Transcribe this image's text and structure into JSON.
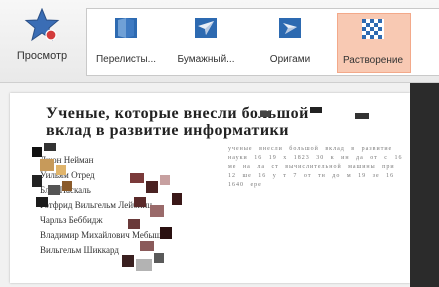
{
  "ribbon": {
    "preview_label": "Просмотр",
    "gallery": [
      {
        "label": "Перелисты...",
        "icon": "book-page-icon",
        "selected": false
      },
      {
        "label": "Бумажный...",
        "icon": "paper-plane-icon",
        "selected": false
      },
      {
        "label": "Оригами",
        "icon": "origami-icon",
        "selected": false
      },
      {
        "label": "Растворение",
        "icon": "dissolve-icon",
        "selected": true
      }
    ]
  },
  "slide": {
    "title_line1": "Ученые, которые внесли большой",
    "title_line2": "вклад в развитие информатики",
    "bullets": [
      "Джон Нейман",
      "Уильям Отред",
      "Блез Паскаль",
      "Готфрид Вильгельм Лейбниц",
      "Чарльз Беббидж",
      "Владимир Михайлович Мебышев",
      "Вильгельм Шиккард"
    ],
    "right_text": "ученые внесли большой вклад в развитие науки 16 19 x 1823 30 к ин да от с 16 ме на ла ст вычислительной машины при 12 ше 16 у т 7 от тн до м 19 зе 16 1640 ере"
  },
  "colors": {
    "accent": "#f8c9b3",
    "star": "#3a6db5",
    "dot": "#d33c3c"
  }
}
